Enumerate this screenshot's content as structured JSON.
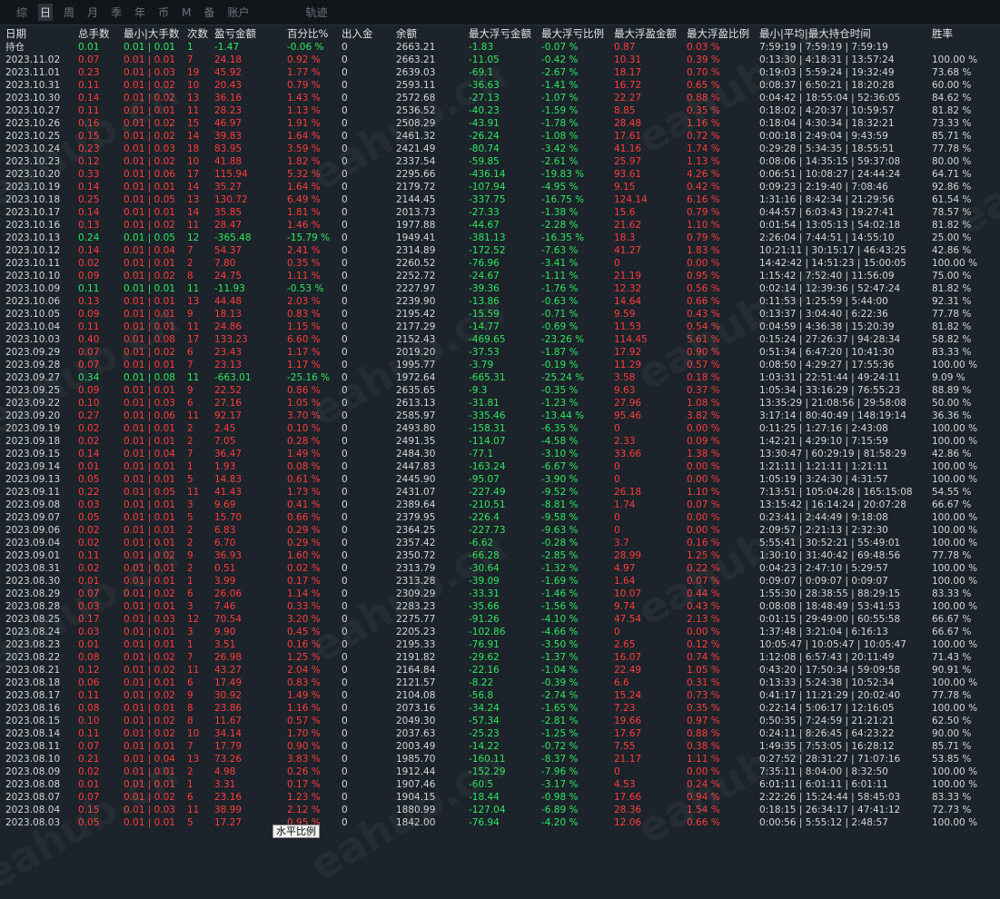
{
  "tabs": [
    "综",
    "日",
    "周",
    "月",
    "季",
    "年",
    "币",
    "M",
    "备",
    "账户",
    "轨迹"
  ],
  "active_tab": 1,
  "headers": [
    "日期",
    "总手数",
    "最小|大手数",
    "次数",
    "盈亏金额",
    "百分比%",
    "出入金",
    "余额",
    "最大浮亏金额",
    "最大浮亏比例",
    "最大浮盈金额",
    "最大浮盈比例",
    "最小|平均|最大持仓时间",
    "胜率"
  ],
  "hold_row": [
    "持仓",
    "0.01",
    "0.01 | 0.01",
    "1",
    "-1.47",
    "-0.06 %",
    "0",
    "2663.21",
    "-1.83",
    "-0.07 %",
    "0.87",
    "0.03 %",
    "7:59:19 | 7:59:19 | 7:59:19",
    ""
  ],
  "rows": [
    [
      "2023.11.02",
      "0.07",
      "0.01 | 0.01",
      "7",
      "24.18",
      "0.92 %",
      "0",
      "2663.21",
      "-11.05",
      "-0.42 %",
      "10.31",
      "0.39 %",
      "0:13:30 | 4:18:31 | 13:57:24",
      "100.00 %"
    ],
    [
      "2023.11.01",
      "0.23",
      "0.01 | 0.03",
      "19",
      "45.92",
      "1.77 %",
      "0",
      "2639.03",
      "-69.1",
      "-2.67 %",
      "18.17",
      "0.70 %",
      "0:19:03 | 5:59:24 | 19:32:49",
      "73.68 %"
    ],
    [
      "2023.10.31",
      "0.11",
      "0.01 | 0.02",
      "10",
      "20.43",
      "0.79 %",
      "0",
      "2593.11",
      "-36.63",
      "-1.41 %",
      "16.72",
      "0.65 %",
      "0:08:37 | 6:50:21 | 18:20:28",
      "60.00 %"
    ],
    [
      "2023.10.30",
      "0.14",
      "0.01 | 0.02",
      "13",
      "36.16",
      "1.43 %",
      "0",
      "2572.68",
      "-27.13",
      "-1.07 %",
      "22.27",
      "0.88 %",
      "0:04:42 | 18:55:04 | 52:36:05",
      "84.62 %"
    ],
    [
      "2023.10.27",
      "0.11",
      "0.01 | 0.01",
      "11",
      "28.23",
      "1.13 %",
      "0",
      "2536.52",
      "-40.23",
      "-1.59 %",
      "8.85",
      "0.35 %",
      "0:18:02 | 4:20:37 | 10:59:57",
      "81.82 %"
    ],
    [
      "2023.10.26",
      "0.16",
      "0.01 | 0.02",
      "15",
      "46.97",
      "1.91 %",
      "0",
      "2508.29",
      "-43.91",
      "-1.78 %",
      "28.48",
      "1.16 %",
      "0:18:04 | 4:30:34 | 18:32:21",
      "73.33 %"
    ],
    [
      "2023.10.25",
      "0.15",
      "0.01 | 0.02",
      "14",
      "39.83",
      "1.64 %",
      "0",
      "2461.32",
      "-26.24",
      "-1.08 %",
      "17.61",
      "0.72 %",
      "0:00:18 | 2:49:04 | 9:43:59",
      "85.71 %"
    ],
    [
      "2023.10.24",
      "0.23",
      "0.01 | 0.03",
      "18",
      "83.95",
      "3.59 %",
      "0",
      "2421.49",
      "-80.74",
      "-3.42 %",
      "41.16",
      "1.74 %",
      "0:29:28 | 5:34:35 | 18:55:51",
      "77.78 %"
    ],
    [
      "2023.10.23",
      "0.12",
      "0.01 | 0.02",
      "10",
      "41.88",
      "1.82 %",
      "0",
      "2337.54",
      "-59.85",
      "-2.61 %",
      "25.97",
      "1.13 %",
      "0:08:06 | 14:35:15 | 59:37:08",
      "80.00 %"
    ],
    [
      "2023.10.20",
      "0.33",
      "0.01 | 0.06",
      "17",
      "115.94",
      "5.32 %",
      "0",
      "2295.66",
      "-436.14",
      "-19.83 %",
      "93.61",
      "4.26 %",
      "0:06:51 | 10:08:27 | 24:44:24",
      "64.71 %"
    ],
    [
      "2023.10.19",
      "0.14",
      "0.01 | 0.01",
      "14",
      "35.27",
      "1.64 %",
      "0",
      "2179.72",
      "-107.94",
      "-4.95 %",
      "9.15",
      "0.42 %",
      "0:09:23 | 2:19:40 | 7:08:46",
      "92.86 %"
    ],
    [
      "2023.10.18",
      "0.25",
      "0.01 | 0.05",
      "13",
      "130.72",
      "6.49 %",
      "0",
      "2144.45",
      "-337.75",
      "-16.75 %",
      "124.14",
      "6.16 %",
      "1:31:16 | 8:42:34 | 21:29:56",
      "61.54 %"
    ],
    [
      "2023.10.17",
      "0.14",
      "0.01 | 0.01",
      "14",
      "35.85",
      "1.81 %",
      "0",
      "2013.73",
      "-27.33",
      "-1.38 %",
      "15.6",
      "0.79 %",
      "0:44:57 | 6:03:43 | 19:27:41",
      "78.57 %"
    ],
    [
      "2023.10.16",
      "0.13",
      "0.01 | 0.02",
      "11",
      "28.47",
      "1.46 %",
      "0",
      "1977.88",
      "-44.67",
      "-2.28 %",
      "21.62",
      "1.10 %",
      "0:01:54 | 13:05:13 | 54:02:18",
      "81.82 %"
    ],
    [
      "2023.10.13",
      "0.24",
      "0.01 | 0.05",
      "12",
      "-365.48",
      "-15.79 %",
      "0",
      "1949.41",
      "-381.13",
      "-16.35 %",
      "18.3",
      "0.79 %",
      "2:26:04 | 7:44:51 | 14:55:10",
      "25.00 %"
    ],
    [
      "2023.10.12",
      "0.14",
      "0.01 | 0.04",
      "7",
      "54.37",
      "2.41 %",
      "0",
      "2314.89",
      "-172.52",
      "-7.63 %",
      "41.27",
      "1.83 %",
      "10:21:11 | 30:15:17 | 46:43:25",
      "42.86 %"
    ],
    [
      "2023.10.11",
      "0.02",
      "0.01 | 0.01",
      "2",
      "7.80",
      "0.35 %",
      "0",
      "2260.52",
      "-76.96",
      "-3.41 %",
      "0",
      "0.00 %",
      "14:42:42 | 14:51:23 | 15:00:05",
      "100.00 %"
    ],
    [
      "2023.10.10",
      "0.09",
      "0.01 | 0.02",
      "8",
      "24.75",
      "1.11 %",
      "0",
      "2252.72",
      "-24.67",
      "-1.11 %",
      "21.19",
      "0.95 %",
      "1:15:42 | 7:52:40 | 11:56:09",
      "75.00 %"
    ],
    [
      "2023.10.09",
      "0.11",
      "0.01 | 0.01",
      "11",
      "-11.93",
      "-0.53 %",
      "0",
      "2227.97",
      "-39.36",
      "-1.76 %",
      "12.32",
      "0.56 %",
      "0:02:14 | 12:39:36 | 52:47:24",
      "81.82 %"
    ],
    [
      "2023.10.06",
      "0.13",
      "0.01 | 0.01",
      "13",
      "44.48",
      "2.03 %",
      "0",
      "2239.90",
      "-13.86",
      "-0.63 %",
      "14.64",
      "0.66 %",
      "0:11:53 | 1:25:59 | 5:44:00",
      "92.31 %"
    ],
    [
      "2023.10.05",
      "0.09",
      "0.01 | 0.01",
      "9",
      "18.13",
      "0.83 %",
      "0",
      "2195.42",
      "-15.59",
      "-0.71 %",
      "9.59",
      "0.43 %",
      "0:13:37 | 3:04:40 | 6:22:36",
      "77.78 %"
    ],
    [
      "2023.10.04",
      "0.11",
      "0.01 | 0.01",
      "11",
      "24.86",
      "1.15 %",
      "0",
      "2177.29",
      "-14.77",
      "-0.69 %",
      "11.53",
      "0.54 %",
      "0:04:59 | 4:36:38 | 15:20:39",
      "81.82 %"
    ],
    [
      "2023.10.03",
      "0.40",
      "0.01 | 0.08",
      "17",
      "133.23",
      "6.60 %",
      "0",
      "2152.43",
      "-469.65",
      "-23.26 %",
      "114.45",
      "5.61 %",
      "0:15:24 | 27:26:37 | 94:28:34",
      "58.82 %"
    ],
    [
      "2023.09.29",
      "0.07",
      "0.01 | 0.02",
      "6",
      "23.43",
      "1.17 %",
      "0",
      "2019.20",
      "-37.53",
      "-1.87 %",
      "17.92",
      "0.90 %",
      "0:51:34 | 6:47:20 | 10:41:30",
      "83.33 %"
    ],
    [
      "2023.09.28",
      "0.07",
      "0.01 | 0.01",
      "7",
      "23.13",
      "1.17 %",
      "0",
      "1995.77",
      "-3.79",
      "-0.19 %",
      "11.29",
      "0.57 %",
      "0:08:50 | 4:29:27 | 17:55:36",
      "100.00 %"
    ],
    [
      "2023.09.27",
      "0.34",
      "0.01 | 0.08",
      "11",
      "-663.01",
      "-25.16 %",
      "0",
      "1972.64",
      "-665.31",
      "-25.24 %",
      "3.58",
      "0.18 %",
      "1:03:31 | 22:51:44 | 49:24:11",
      "9.09 %"
    ],
    [
      "2023.09.25",
      "0.09",
      "0.01 | 0.01",
      "9",
      "22.52",
      "0.86 %",
      "0",
      "2635.65",
      "-9.3",
      "-0.35 %",
      "9.63",
      "0.37 %",
      "1:05:34 | 33:16:29 | 76:55:23",
      "88.89 %"
    ],
    [
      "2023.09.22",
      "0.10",
      "0.01 | 0.03",
      "6",
      "27.16",
      "1.05 %",
      "0",
      "2613.13",
      "-31.81",
      "-1.23 %",
      "27.96",
      "1.08 %",
      "13:35:29 | 21:08:56 | 29:58:08",
      "50.00 %"
    ],
    [
      "2023.09.20",
      "0.27",
      "0.01 | 0.06",
      "11",
      "92.17",
      "3.70 %",
      "0",
      "2585.97",
      "-335.46",
      "-13.44 %",
      "95.46",
      "3.82 %",
      "3:17:14 | 80:40:49 | 148:19:14",
      "36.36 %"
    ],
    [
      "2023.09.19",
      "0.02",
      "0.01 | 0.01",
      "2",
      "2.45",
      "0.10 %",
      "0",
      "2493.80",
      "-158.31",
      "-6.35 %",
      "0",
      "0.00 %",
      "0:11:25 | 1:27:16 | 2:43:08",
      "100.00 %"
    ],
    [
      "2023.09.18",
      "0.02",
      "0.01 | 0.01",
      "2",
      "7.05",
      "0.28 %",
      "0",
      "2491.35",
      "-114.07",
      "-4.58 %",
      "2.33",
      "0.09 %",
      "1:42:21 | 4:29:10 | 7:15:59",
      "100.00 %"
    ],
    [
      "2023.09.15",
      "0.14",
      "0.01 | 0.04",
      "7",
      "36.47",
      "1.49 %",
      "0",
      "2484.30",
      "-77.1",
      "-3.10 %",
      "33.66",
      "1.38 %",
      "13:30:47 | 60:29:19 | 81:58:29",
      "42.86 %"
    ],
    [
      "2023.09.14",
      "0.01",
      "0.01 | 0.01",
      "1",
      "1.93",
      "0.08 %",
      "0",
      "2447.83",
      "-163.24",
      "-6.67 %",
      "0",
      "0.00 %",
      "1:21:11 | 1:21:11 | 1:21:11",
      "100.00 %"
    ],
    [
      "2023.09.13",
      "0.05",
      "0.01 | 0.01",
      "5",
      "14.83",
      "0.61 %",
      "0",
      "2445.90",
      "-95.07",
      "-3.90 %",
      "0",
      "0.00 %",
      "1:05:19 | 3:24:30 | 4:31:57",
      "100.00 %"
    ],
    [
      "2023.09.11",
      "0.22",
      "0.01 | 0.05",
      "11",
      "41.43",
      "1.73 %",
      "0",
      "2431.07",
      "-227.49",
      "-9.52 %",
      "26.18",
      "1.10 %",
      "7:13:51 | 105:04:28 | 165:15:08",
      "54.55 %"
    ],
    [
      "2023.09.08",
      "0.03",
      "0.01 | 0.01",
      "3",
      "9.69",
      "0.41 %",
      "0",
      "2389.64",
      "-210.51",
      "-8.81 %",
      "1.74",
      "0.07 %",
      "13:15:42 | 16:14:24 | 20:07:28",
      "66.67 %"
    ],
    [
      "2023.09.07",
      "0.05",
      "0.01 | 0.01",
      "5",
      "15.70",
      "0.66 %",
      "0",
      "2379.95",
      "-226.4",
      "-9.58 %",
      "0",
      "0.00 %",
      "0:23:41 | 2:44:49 | 9:18:08",
      "100.00 %"
    ],
    [
      "2023.09.06",
      "0.02",
      "0.01 | 0.01",
      "2",
      "6.83",
      "0.29 %",
      "0",
      "2364.25",
      "-227.73",
      "-9.63 %",
      "0",
      "0.00 %",
      "2:09:57 | 2:21:13 | 2:32:30",
      "100.00 %"
    ],
    [
      "2023.09.04",
      "0.02",
      "0.01 | 0.01",
      "2",
      "6.70",
      "0.29 %",
      "0",
      "2357.42",
      "-6.62",
      "-0.28 %",
      "3.7",
      "0.16 %",
      "5:55:41 | 30:52:21 | 55:49:01",
      "100.00 %"
    ],
    [
      "2023.09.01",
      "0.11",
      "0.01 | 0.02",
      "9",
      "36.93",
      "1.60 %",
      "0",
      "2350.72",
      "-66.28",
      "-2.85 %",
      "28.99",
      "1.25 %",
      "1:30:10 | 31:40:42 | 69:48:56",
      "77.78 %"
    ],
    [
      "2023.08.31",
      "0.02",
      "0.01 | 0.01",
      "2",
      "0.51",
      "0.02 %",
      "0",
      "2313.79",
      "-30.64",
      "-1.32 %",
      "4.97",
      "0.22 %",
      "0:04:23 | 2:47:10 | 5:29:57",
      "100.00 %"
    ],
    [
      "2023.08.30",
      "0.01",
      "0.01 | 0.01",
      "1",
      "3.99",
      "0.17 %",
      "0",
      "2313.28",
      "-39.09",
      "-1.69 %",
      "1.64",
      "0.07 %",
      "0:09:07 | 0:09:07 | 0:09:07",
      "100.00 %"
    ],
    [
      "2023.08.29",
      "0.07",
      "0.01 | 0.02",
      "6",
      "26.06",
      "1.14 %",
      "0",
      "2309.29",
      "-33.31",
      "-1.46 %",
      "10.07",
      "0.44 %",
      "1:55:30 | 28:38:55 | 88:29:15",
      "83.33 %"
    ],
    [
      "2023.08.28",
      "0.03",
      "0.01 | 0.01",
      "3",
      "7.46",
      "0.33 %",
      "0",
      "2283.23",
      "-35.66",
      "-1.56 %",
      "9.74",
      "0.43 %",
      "0:08:08 | 18:48:49 | 53:41:53",
      "100.00 %"
    ],
    [
      "2023.08.25",
      "0.17",
      "0.01 | 0.03",
      "12",
      "70.54",
      "3.20 %",
      "0",
      "2275.77",
      "-91.26",
      "-4.10 %",
      "47.54",
      "2.13 %",
      "0:01:15 | 29:49:00 | 60:55:58",
      "66.67 %"
    ],
    [
      "2023.08.24",
      "0.03",
      "0.01 | 0.01",
      "3",
      "9.90",
      "0.45 %",
      "0",
      "2205.23",
      "-102.86",
      "-4.66 %",
      "0",
      "0.00 %",
      "1:37:48 | 3:21:04 | 6:16:13",
      "66.67 %"
    ],
    [
      "2023.08.23",
      "0.01",
      "0.01 | 0.01",
      "1",
      "3.51",
      "0.16 %",
      "0",
      "2195.33",
      "-76.91",
      "-3.50 %",
      "2.65",
      "0.12 %",
      "10:05:47 | 10:05:47 | 10:05:47",
      "100.00 %"
    ],
    [
      "2023.08.22",
      "0.08",
      "0.01 | 0.02",
      "7",
      "26.98",
      "1.25 %",
      "0",
      "2191.82",
      "-29.62",
      "-1.37 %",
      "16.07",
      "0.74 %",
      "1:12:08 | 6:57:43 | 20:11:49",
      "71.43 %"
    ],
    [
      "2023.08.21",
      "0.12",
      "0.01 | 0.02",
      "11",
      "43.27",
      "2.04 %",
      "0",
      "2164.84",
      "-22.16",
      "-1.04 %",
      "22.49",
      "1.05 %",
      "0:43:20 | 17:50:34 | 59:09:58",
      "90.91 %"
    ],
    [
      "2023.08.18",
      "0.06",
      "0.01 | 0.01",
      "6",
      "17.49",
      "0.83 %",
      "0",
      "2121.57",
      "-8.22",
      "-0.39 %",
      "6.6",
      "0.31 %",
      "0:13:33 | 5:24:38 | 10:52:34",
      "100.00 %"
    ],
    [
      "2023.08.17",
      "0.11",
      "0.01 | 0.02",
      "9",
      "30.92",
      "1.49 %",
      "0",
      "2104.08",
      "-56.8",
      "-2.74 %",
      "15.24",
      "0.73 %",
      "0:41:17 | 11:21:29 | 20:02:40",
      "77.78 %"
    ],
    [
      "2023.08.16",
      "0.08",
      "0.01 | 0.01",
      "8",
      "23.86",
      "1.16 %",
      "0",
      "2073.16",
      "-34.24",
      "-1.65 %",
      "7.23",
      "0.35 %",
      "0:22:14 | 5:06:17 | 12:16:05",
      "100.00 %"
    ],
    [
      "2023.08.15",
      "0.10",
      "0.01 | 0.02",
      "8",
      "11.67",
      "0.57 %",
      "0",
      "2049.30",
      "-57.34",
      "-2.81 %",
      "19.66",
      "0.97 %",
      "0:50:35 | 7:24:59 | 21:21:21",
      "62.50 %"
    ],
    [
      "2023.08.14",
      "0.11",
      "0.01 | 0.02",
      "10",
      "34.14",
      "1.70 %",
      "0",
      "2037.63",
      "-25.23",
      "-1.25 %",
      "17.67",
      "0.88 %",
      "0:24:11 | 8:26:45 | 64:23:22",
      "90.00 %"
    ],
    [
      "2023.08.11",
      "0.07",
      "0.01 | 0.01",
      "7",
      "17.79",
      "0.90 %",
      "0",
      "2003.49",
      "-14.22",
      "-0.72 %",
      "7.55",
      "0.38 %",
      "1:49:35 | 7:53:05 | 16:28:12",
      "85.71 %"
    ],
    [
      "2023.08.10",
      "0.21",
      "0.01 | 0.04",
      "13",
      "73.26",
      "3.83 %",
      "0",
      "1985.70",
      "-160.11",
      "-8.37 %",
      "21.17",
      "1.11 %",
      "0:27:52 | 28:31:27 | 71:07:16",
      "53.85 %"
    ],
    [
      "2023.08.09",
      "0.02",
      "0.01 | 0.01",
      "2",
      "4.98",
      "0.26 %",
      "0",
      "1912.44",
      "-152.29",
      "-7.96 %",
      "0",
      "0.00 %",
      "7:35:11 | 8:04:00 | 8:32:50",
      "100.00 %"
    ],
    [
      "2023.08.08",
      "0.01",
      "0.01 | 0.01",
      "1",
      "3.31",
      "0.17 %",
      "0",
      "1907.46",
      "-60.5",
      "-3.17 %",
      "4.53",
      "0.24 %",
      "6:01:11 | 6:01:11 | 6:01:11",
      "100.00 %"
    ],
    [
      "2023.08.07",
      "0.07",
      "0.01 | 0.02",
      "6",
      "23.16",
      "1.23 %",
      "0",
      "1904.15",
      "-18.44",
      "-0.98 %",
      "17.66",
      "0.94 %",
      "2:22:26 | 15:24:44 | 58:45:03",
      "83.33 %"
    ],
    [
      "2023.08.04",
      "0.15",
      "0.01 | 0.03",
      "11",
      "38.99",
      "2.12 %",
      "0",
      "1880.99",
      "-127.04",
      "-6.89 %",
      "28.36",
      "1.54 %",
      "0:18:15 | 26:34:17 | 47:41:12",
      "72.73 %"
    ],
    [
      "2023.08.03",
      "0.05",
      "0.01 | 0.01",
      "5",
      "17.27",
      "0.95 %",
      "0",
      "1842.00",
      "-76.94",
      "-4.20 %",
      "12.06",
      "0.66 %",
      "0:00:56 | 5:55:12 | 2:48:57",
      "100.00 %"
    ]
  ],
  "watermark": "eahub.cn",
  "tooltip": "水平比例",
  "colors": {
    "positive": "#ff3c3c",
    "negative": "#2ee860",
    "background": "#1c232a",
    "text": "#d6d6d6"
  }
}
